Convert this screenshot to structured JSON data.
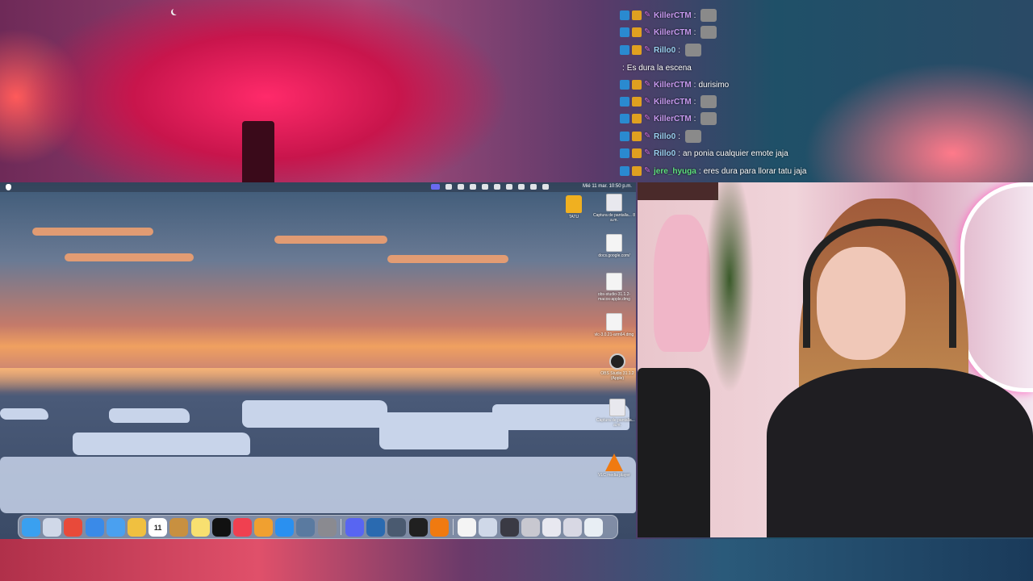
{
  "chat": {
    "messages": [
      {
        "user": "KillerCTM",
        "text": "",
        "emote": true,
        "user_color": "#c89af0"
      },
      {
        "user": "KillerCTM",
        "text": "",
        "emote": true,
        "user_color": "#c89af0"
      },
      {
        "user": "Rillo0",
        "text": "",
        "emote": true,
        "user_color": "#9ad0f0"
      },
      {
        "user": "",
        "text": "Es dura la escena",
        "emote": false,
        "user_color": "#e04050"
      },
      {
        "user": "KillerCTM",
        "text": "durisimo",
        "emote": false,
        "user_color": "#c89af0"
      },
      {
        "user": "KillerCTM",
        "text": "",
        "emote": true,
        "user_color": "#c89af0"
      },
      {
        "user": "KillerCTM",
        "text": "",
        "emote": true,
        "user_color": "#c89af0"
      },
      {
        "user": "Rillo0",
        "text": "",
        "emote": true,
        "user_color": "#9ad0f0"
      },
      {
        "user": "Rillo0",
        "text": "an ponia cualquier emote jaja",
        "emote": false,
        "user_color": "#9ad0f0"
      },
      {
        "user": "jere_hyuga",
        "text": "eres dura para llorar tatu jaja",
        "emote": false,
        "user_color": "#60e080"
      }
    ]
  },
  "mac": {
    "menubar": {
      "clock": "Mié 11 mar. 10:50 p.m."
    },
    "desktop_icons": [
      {
        "label": "TATU",
        "kind": "folder"
      },
      {
        "label": "Captura de pantalla... 8 a.m.",
        "kind": "shot"
      },
      {
        "label": "docs.google.com/",
        "kind": "doc"
      },
      {
        "label": "obs-studio-31.1.2-macos-apple.dmg",
        "kind": "doc"
      },
      {
        "label": "vlc-3.0.21-arm64.dmg",
        "kind": "doc"
      },
      {
        "label": "OBS Studio 31.1.2 (Apple)",
        "kind": "obs"
      },
      {
        "label": "Captura de pantalla... 9 a.m.",
        "kind": "shot"
      },
      {
        "label": "VLC media player",
        "kind": "vlc"
      }
    ],
    "dock": {
      "calendar_day": "11",
      "apps": [
        {
          "name": "finder-icon",
          "color": "#3aa0f0"
        },
        {
          "name": "launchpad-icon",
          "color": "#d0d8e8"
        },
        {
          "name": "chrome-icon",
          "color": "#e84a3a"
        },
        {
          "name": "safari-icon",
          "color": "#3a8ae8"
        },
        {
          "name": "mail-icon",
          "color": "#4aa0f0"
        },
        {
          "name": "photos-icon",
          "color": "#f0c040"
        },
        {
          "name": "calendar-icon",
          "color": "#ffffff"
        },
        {
          "name": "app-orange-icon",
          "color": "#c89040"
        },
        {
          "name": "notes-icon",
          "color": "#f8e070"
        },
        {
          "name": "apple-tv-icon",
          "color": "#111111"
        },
        {
          "name": "music-icon",
          "color": "#f04050"
        },
        {
          "name": "pages-icon",
          "color": "#f0a030"
        },
        {
          "name": "app-store-icon",
          "color": "#2a90f0"
        },
        {
          "name": "iphone-mirroring-icon",
          "color": "#5a7aa0"
        },
        {
          "name": "system-settings-icon",
          "color": "#8a8a90"
        },
        {
          "name": "discord-icon",
          "color": "#5865f2"
        },
        {
          "name": "app-blue-icon",
          "color": "#2a6ab0"
        },
        {
          "name": "screenshot-app-icon",
          "color": "#4a5a70"
        },
        {
          "name": "obs-icon",
          "color": "#202020"
        },
        {
          "name": "vlc-icon",
          "color": "#f07a10"
        },
        {
          "name": "doc-file-icon",
          "color": "#f4f4f4"
        },
        {
          "name": "window-icon-1",
          "color": "#cfd8e8"
        },
        {
          "name": "window-icon-2",
          "color": "#3a3a44"
        },
        {
          "name": "window-icon-3",
          "color": "#c8c8d0"
        },
        {
          "name": "window-icon-4",
          "color": "#e8e8f0"
        },
        {
          "name": "window-icon-5",
          "color": "#d8d8e4"
        },
        {
          "name": "trash-icon",
          "color": "#e8eef4"
        }
      ]
    }
  }
}
